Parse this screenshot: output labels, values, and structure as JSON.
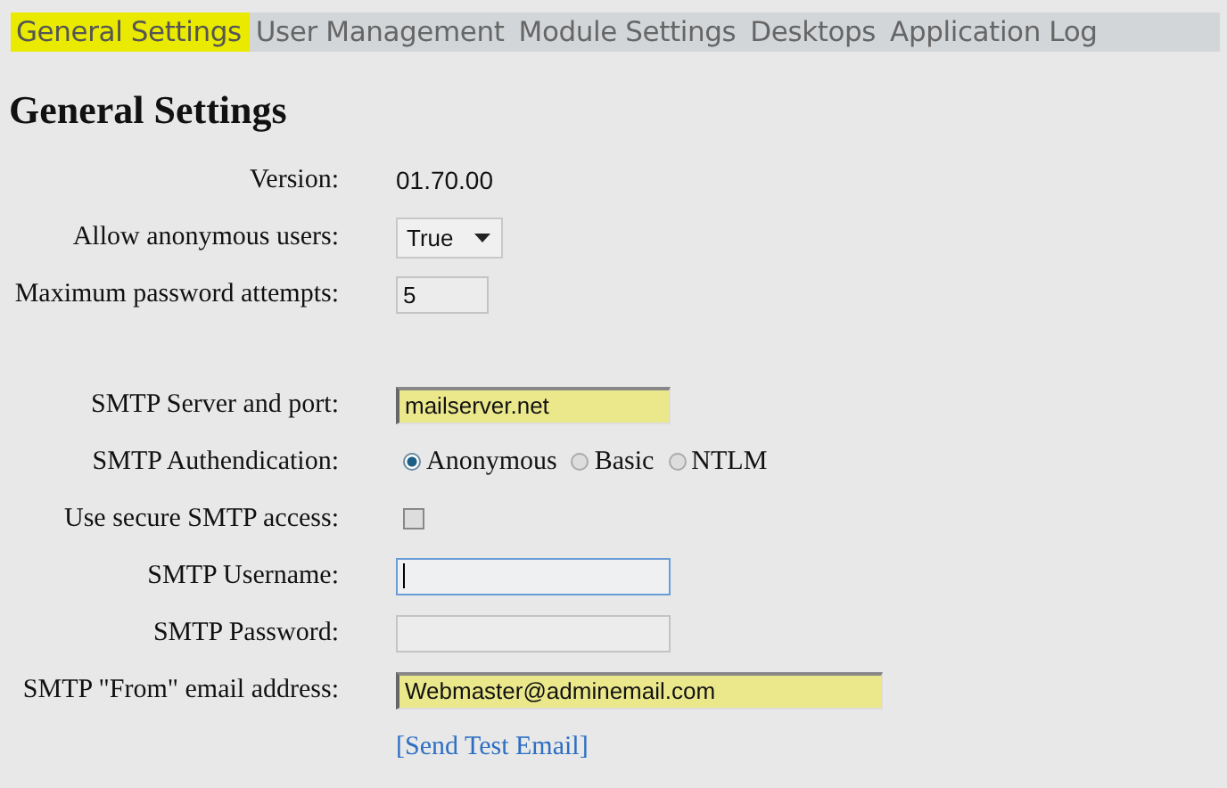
{
  "tabs": [
    {
      "label": "General Settings",
      "selected": true
    },
    {
      "label": "User Management",
      "selected": false
    },
    {
      "label": "Module Settings",
      "selected": false
    },
    {
      "label": "Desktops",
      "selected": false
    },
    {
      "label": "Application Log",
      "selected": false
    }
  ],
  "heading": "General Settings",
  "sections": [
    {
      "rows": [
        {
          "kind": "text",
          "label": "Version:",
          "value": "01.70.00"
        },
        {
          "kind": "select",
          "label": "Allow anonymous users:",
          "value": "True"
        },
        {
          "kind": "input",
          "label": "Maximum password attempts:",
          "value": "5",
          "highlighted": false,
          "focused": false
        }
      ]
    },
    {
      "rows": [
        {
          "kind": "input",
          "label": "SMTP Server and port:",
          "value": "mailserver.net",
          "highlighted": true,
          "focused": false
        },
        {
          "kind": "radio",
          "label": "SMTP Authendication:",
          "options": [
            {
              "label": "Anonymous",
              "selected": true
            },
            {
              "label": "Basic",
              "selected": false
            },
            {
              "label": "NTLM",
              "selected": false
            }
          ]
        },
        {
          "kind": "checkbox",
          "label": "Use secure SMTP access:",
          "checked": false
        },
        {
          "kind": "input",
          "label": "SMTP Username:",
          "highlighted": false,
          "focused": true
        },
        {
          "kind": "input",
          "label": "SMTP Password:",
          "highlighted": false,
          "focused": false
        },
        {
          "kind": "input",
          "label": "SMTP \"From\" email address:",
          "value": "Webmaster@adminemail.com",
          "highlighted": true,
          "focused": false
        },
        {
          "kind": "link",
          "value": "[Send Test Email]"
        }
      ]
    }
  ]
}
